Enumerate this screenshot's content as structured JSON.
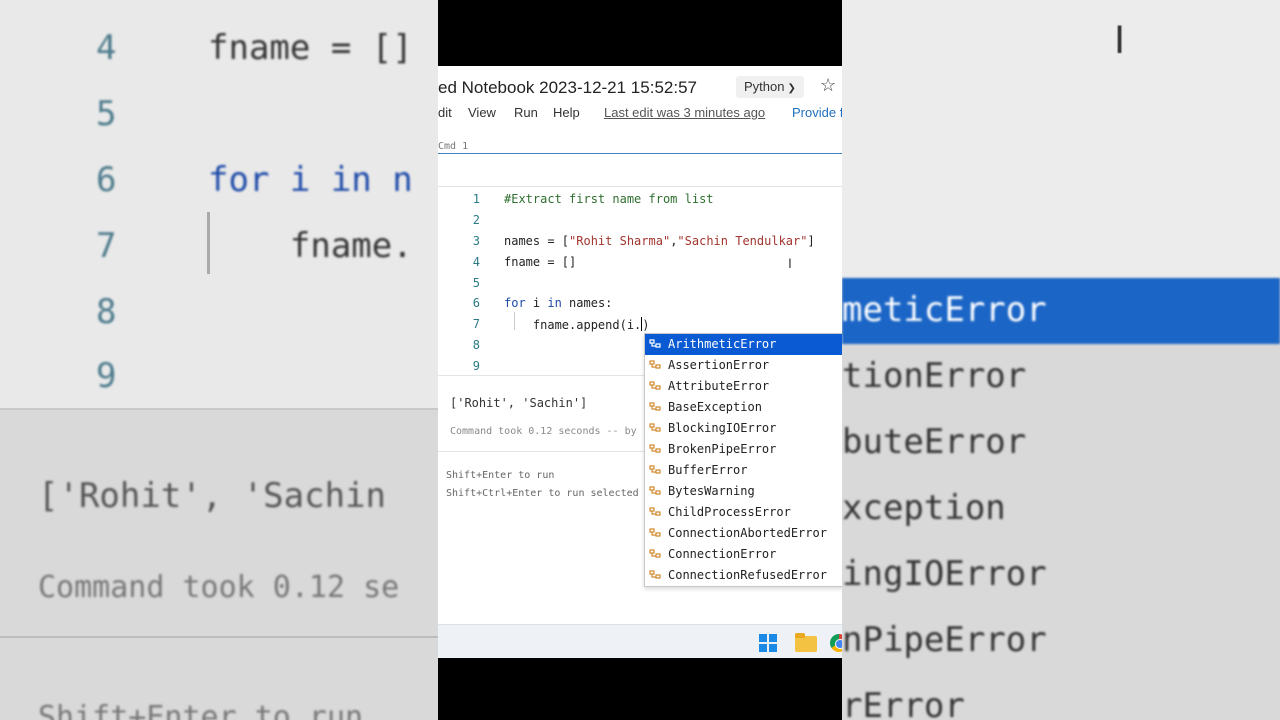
{
  "background_left": {
    "line_numbers": [
      "4",
      "5",
      "6",
      "7",
      "8",
      "9"
    ],
    "code_lines": [
      "fname = []",
      "",
      "for i in n",
      "    fname.",
      "",
      ""
    ],
    "output": "['Rohit', 'Sachin",
    "took": "Command took 0.12 se",
    "hint": "Shift+Enter to run"
  },
  "background_right": {
    "items": [
      "meticError",
      "tionError",
      "buteError",
      "xception",
      "ingIOError",
      "nPipeError",
      "rError"
    ]
  },
  "notebook": {
    "title": "ed Notebook 2023-12-21 15:52:57",
    "language": "Python",
    "menu": [
      "dit",
      "View",
      "Run",
      "Help"
    ],
    "last_edit": "Last edit was 3 minutes ago",
    "provide": "Provide f",
    "cmd_label": "Cmd 1"
  },
  "editor": {
    "line_numbers": [
      "1",
      "2",
      "3",
      "4",
      "5",
      "6",
      "7",
      "8",
      "9"
    ],
    "line1": "#Extract first name from list",
    "line3_a": "names = [",
    "line3_s1": "\"Rohit Sharma\"",
    "line3_b": ",",
    "line3_s2": "\"Sachin Tendulkar\"",
    "line3_c": "]",
    "line4": "fname = []",
    "line6_kw1": "for",
    "line6_a": " i ",
    "line6_kw2": "in",
    "line6_b": " names:",
    "line7": "    fname.append(i.",
    "line7_close": ")"
  },
  "output": {
    "result": "['Rohit', 'Sachin']",
    "took": "Command took 0.12 seconds -- by"
  },
  "hints": {
    "run": "Shift+Enter to run",
    "run_selected": "Shift+Ctrl+Enter to run selected"
  },
  "autocomplete": {
    "items": [
      "ArithmeticError",
      "AssertionError",
      "AttributeError",
      "BaseException",
      "BlockingIOError",
      "BrokenPipeError",
      "BufferError",
      "BytesWarning",
      "ChildProcessError",
      "ConnectionAbortedError",
      "ConnectionError",
      "ConnectionRefusedError"
    ],
    "selected_index": 0
  },
  "colors": {
    "selection": "#0a5bd3",
    "line_number": "#2b7a86",
    "string": "#a3362e",
    "keyword": "#1d4aa8",
    "comment": "#2f6f2f"
  },
  "icons": [
    "star-icon",
    "chevron-down-icon",
    "class-icon",
    "windows-start-icon",
    "file-explorer-icon",
    "chrome-icon"
  ]
}
